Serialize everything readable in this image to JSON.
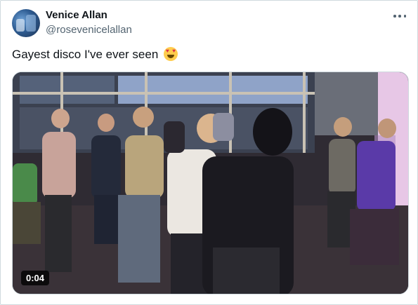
{
  "post": {
    "author": {
      "display_name": "Venice Allan",
      "handle": "@rosevenicelallan"
    },
    "text": "Gayest disco I've ever seen",
    "emoji_icon": "heart-eyes-emoji-icon",
    "media": {
      "type": "video",
      "duration": "0:04"
    }
  },
  "colors": {
    "text_primary": "#0f1419",
    "text_secondary": "#536471",
    "border": "#cfd9de"
  }
}
